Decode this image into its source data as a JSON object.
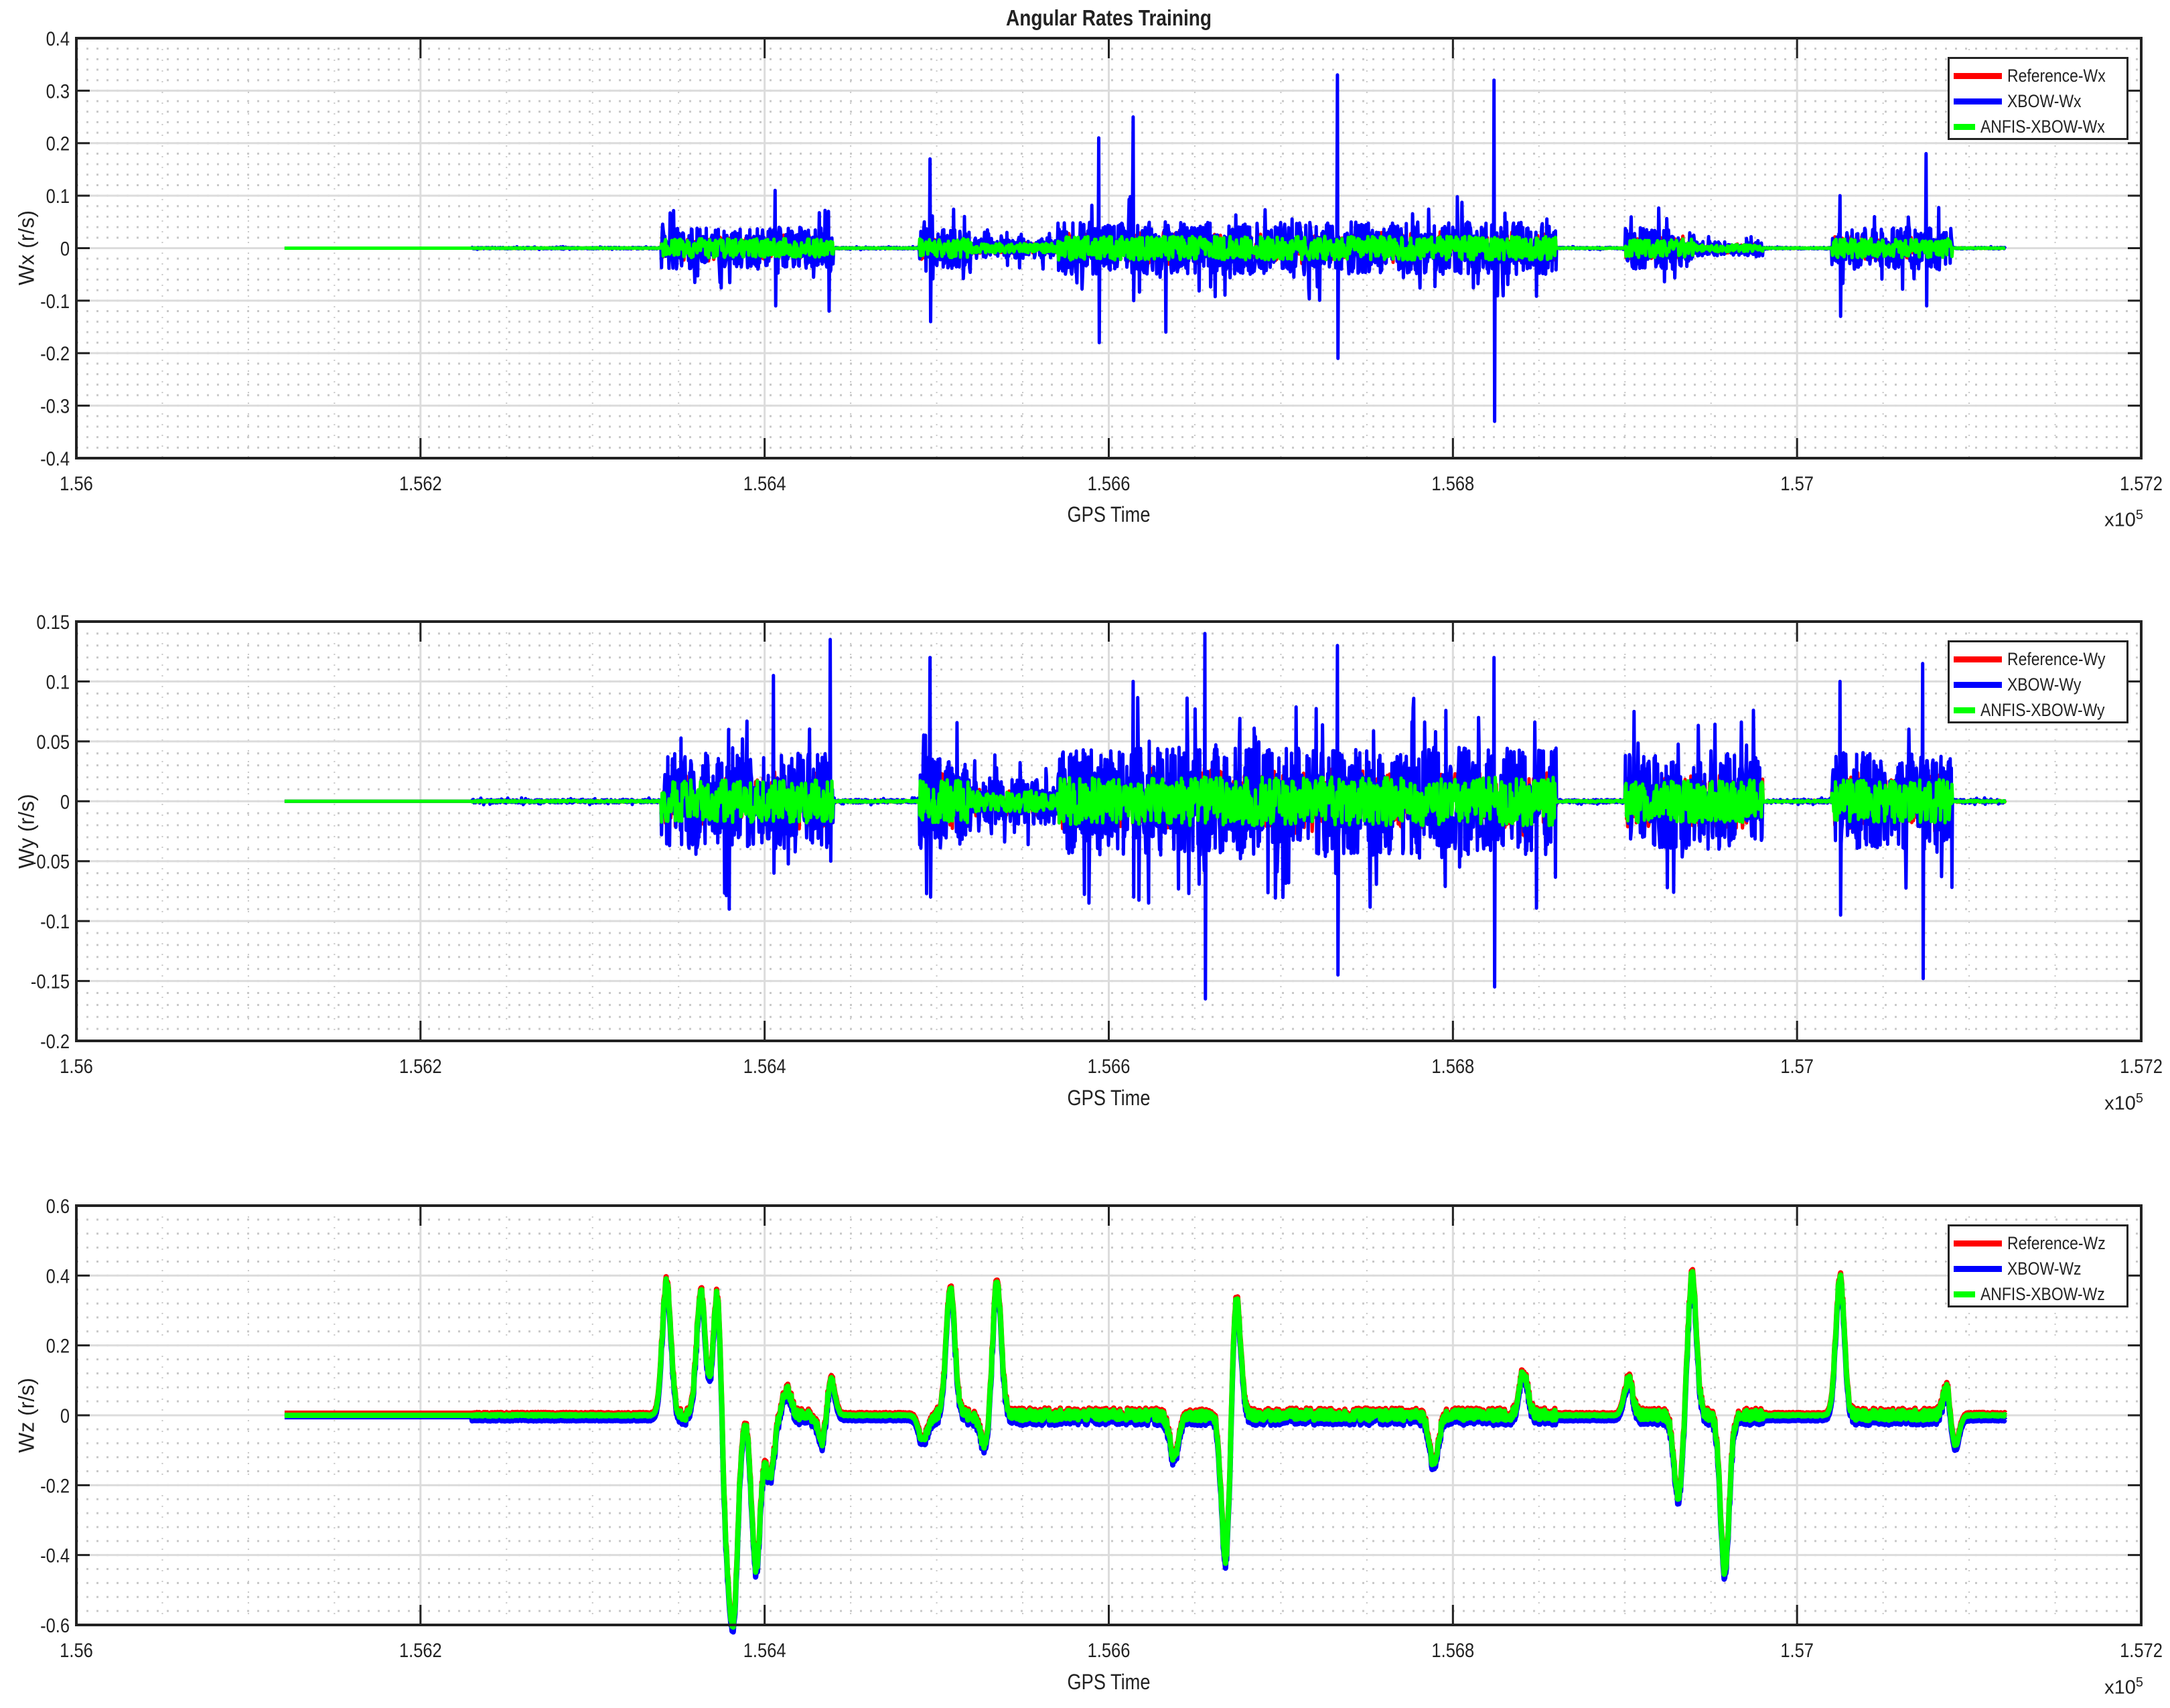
{
  "title": "Angular Rates Training",
  "colors": {
    "reference": "#ff0000",
    "xbow": "#0000ff",
    "anfis": "#00ff00"
  },
  "chart_data": [
    {
      "type": "line",
      "title": "Angular Rates Training",
      "xlabel": "GPS Time",
      "x_exponent_base": "x10",
      "x_exponent": "5",
      "ylabel": "Wx (r/s)",
      "xlim": [
        1.56,
        1.572
      ],
      "ylim": [
        -0.4,
        0.4
      ],
      "xticks": [
        "1.56",
        "1.562",
        "1.564",
        "1.566",
        "1.568",
        "1.57",
        "1.572"
      ],
      "yticks": [
        "-0.4",
        "-0.3",
        "-0.2",
        "-0.1",
        "0",
        "0.1",
        "0.2",
        "0.3",
        "0.4"
      ],
      "grid": true,
      "legend_position": "top-right",
      "legend": [
        "Reference-Wx",
        "XBOW-Wx",
        "ANFIS-XBOW-Wx"
      ],
      "x_range": [
        1.56121,
        1.57121
      ],
      "active_regions": [
        [
          1.5634,
          1.5644,
          0.04
        ],
        [
          1.5649,
          1.5652,
          0.04
        ],
        [
          1.5652,
          1.5657,
          0.02
        ],
        [
          1.5657,
          1.5686,
          0.05
        ],
        [
          1.569,
          1.5694,
          0.04
        ],
        [
          1.5694,
          1.5698,
          0.015
        ],
        [
          1.5702,
          1.5709,
          0.04
        ]
      ],
      "xbow_spikes": [
        [
          1.56733,
          0.33,
          -0.21
        ],
        [
          1.56824,
          0.32,
          -0.33
        ],
        [
          1.56614,
          0.25,
          -0.1
        ],
        [
          1.56594,
          0.21,
          -0.18
        ],
        [
          1.56633,
          0.05,
          -0.16
        ],
        [
          1.56496,
          0.17,
          -0.14
        ],
        [
          1.57075,
          0.18,
          -0.11
        ],
        [
          1.57025,
          0.1,
          -0.13
        ],
        [
          1.56406,
          0.11,
          -0.11
        ],
        [
          1.56437,
          0.07,
          -0.12
        ]
      ]
    },
    {
      "type": "line",
      "xlabel": "GPS Time",
      "x_exponent_base": "x10",
      "x_exponent": "5",
      "ylabel": "Wy (r/s)",
      "xlim": [
        1.56,
        1.572
      ],
      "ylim": [
        -0.2,
        0.15
      ],
      "xticks": [
        "1.56",
        "1.562",
        "1.564",
        "1.566",
        "1.568",
        "1.57",
        "1.572"
      ],
      "yticks": [
        "-0.2",
        "-0.15",
        "-0.1",
        "-0.05",
        "0",
        "0.05",
        "0.1",
        "0.15"
      ],
      "grid": true,
      "legend_position": "top-right",
      "legend": [
        "Reference-Wy",
        "XBOW-Wy",
        "ANFIS-XBOW-Wy"
      ],
      "x_range": [
        1.56121,
        1.57121
      ],
      "active_regions": [
        [
          1.5634,
          1.5644,
          0.04
        ],
        [
          1.5649,
          1.5652,
          0.04
        ],
        [
          1.5652,
          1.5657,
          0.02
        ],
        [
          1.5657,
          1.5686,
          0.045
        ],
        [
          1.569,
          1.5698,
          0.04
        ],
        [
          1.5702,
          1.5709,
          0.04
        ]
      ],
      "xbow_spikes": [
        [
          1.56438,
          0.135,
          -0.05
        ],
        [
          1.56496,
          0.12,
          -0.08
        ],
        [
          1.56656,
          0.14,
          -0.165
        ],
        [
          1.56733,
          0.13,
          -0.145
        ],
        [
          1.56824,
          0.12,
          -0.155
        ],
        [
          1.57073,
          0.115,
          -0.148
        ],
        [
          1.57025,
          0.1,
          -0.095
        ],
        [
          1.56379,
          0.06,
          -0.09
        ],
        [
          1.56405,
          0.105,
          -0.06
        ],
        [
          1.56614,
          0.1,
          -0.08
        ]
      ]
    },
    {
      "type": "line",
      "xlabel": "GPS Time",
      "x_exponent_base": "x10",
      "x_exponent": "5",
      "ylabel": "Wz (r/s)",
      "xlim": [
        1.56,
        1.572
      ],
      "ylim": [
        -0.6,
        0.6
      ],
      "xticks": [
        "1.56",
        "1.562",
        "1.564",
        "1.566",
        "1.568",
        "1.57",
        "1.572"
      ],
      "yticks": [
        "-0.6",
        "-0.4",
        "-0.2",
        "0",
        "0.2",
        "0.4",
        "0.6"
      ],
      "grid": true,
      "legend_position": "top-right",
      "legend": [
        "Reference-Wz",
        "XBOW-Wz",
        "ANFIS-XBOW-Wz"
      ],
      "x_range": [
        1.56121,
        1.57121
      ],
      "active_regions": [
        [
          1.5634,
          1.5644,
          0.01
        ],
        [
          1.5649,
          1.5686,
          0.01
        ],
        [
          1.569,
          1.5698,
          0.01
        ],
        [
          1.5702,
          1.5709,
          0.01
        ]
      ],
      "peaks": [
        [
          1.56343,
          0.38
        ],
        [
          1.56363,
          0.36
        ],
        [
          1.56373,
          0.42
        ],
        [
          1.56377,
          -0.35
        ],
        [
          1.56382,
          -0.54
        ],
        [
          1.56395,
          -0.44
        ],
        [
          1.56403,
          -0.18
        ],
        [
          1.56413,
          0.07
        ],
        [
          1.56434,
          -0.1
        ],
        [
          1.56438,
          0.12
        ],
        [
          1.56492,
          -0.07
        ],
        [
          1.56508,
          0.37
        ],
        [
          1.56528,
          -0.09
        ],
        [
          1.56535,
          0.38
        ],
        [
          1.56638,
          -0.12
        ],
        [
          1.56668,
          -0.43
        ],
        [
          1.56674,
          0.35
        ],
        [
          1.56789,
          -0.14
        ],
        [
          1.56841,
          0.12
        ],
        [
          1.56902,
          0.1
        ],
        [
          1.56931,
          -0.23
        ],
        [
          1.56939,
          0.4
        ],
        [
          1.56958,
          -0.45
        ],
        [
          1.57025,
          0.39
        ],
        [
          1.57088,
          0.12
        ],
        [
          1.57091,
          -0.13
        ]
      ]
    }
  ]
}
